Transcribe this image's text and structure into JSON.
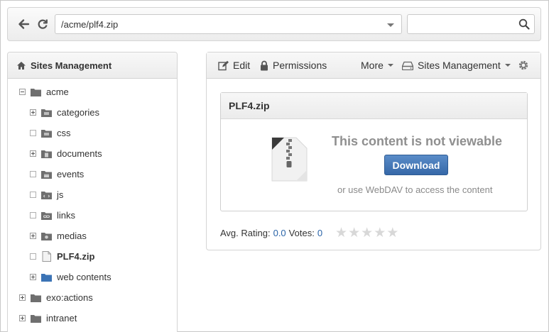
{
  "address": {
    "value": "/acme/plf4.zip"
  },
  "search": {
    "placeholder": ""
  },
  "sidebar": {
    "title": "Sites Management",
    "items": [
      {
        "label": "acme",
        "toggle": "minus",
        "icon": "folder-icon"
      },
      {
        "label": "categories",
        "toggle": "plus",
        "icon": "category-folder-icon"
      },
      {
        "label": "css",
        "toggle": "none",
        "icon": "css-folder-icon"
      },
      {
        "label": "documents",
        "toggle": "plus",
        "icon": "document-folder-icon"
      },
      {
        "label": "events",
        "toggle": "none",
        "icon": "calendar-folder-icon"
      },
      {
        "label": "js",
        "toggle": "none",
        "icon": "script-folder-icon"
      },
      {
        "label": "links",
        "toggle": "none",
        "icon": "link-folder-icon"
      },
      {
        "label": "medias",
        "toggle": "plus",
        "icon": "media-folder-icon"
      },
      {
        "label": "PLF4.zip",
        "toggle": "none",
        "icon": "file-icon",
        "selected": true
      },
      {
        "label": "web contents",
        "toggle": "plus",
        "icon": "blue-folder-icon"
      },
      {
        "label": "exo:actions",
        "toggle": "plus",
        "icon": "folder-icon"
      },
      {
        "label": "intranet",
        "toggle": "plus",
        "icon": "folder-icon"
      }
    ]
  },
  "actions": {
    "edit": "Edit",
    "permissions": "Permissions",
    "more": "More",
    "drive": "Sites Management"
  },
  "preview": {
    "title": "PLF4.zip",
    "message": "This content is not viewable",
    "download": "Download",
    "webdav": "or use WebDAV to access the content"
  },
  "rating": {
    "avg_label": "Avg. Rating:",
    "avg_value": "0.0",
    "votes_label": "Votes:",
    "votes_value": "0",
    "stars_filled": 0,
    "stars_total": 5
  },
  "colors": {
    "accent": "#3668a8",
    "link": "#2a64a8",
    "folder": "#707070",
    "web_folder": "#3b73b5"
  }
}
